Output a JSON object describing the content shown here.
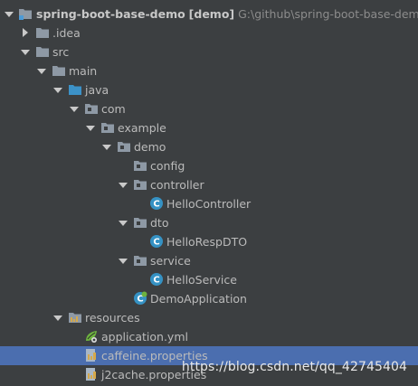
{
  "project": {
    "name": "spring-boot-base-demo",
    "module_tag": "[demo]",
    "path": "G:\\github\\spring-boot-base-demo"
  },
  "tree": {
    "idea": ".idea",
    "src": "src",
    "main": "main",
    "java": "java",
    "com": "com",
    "example": "example",
    "demo": "demo",
    "config": "config",
    "controller": "controller",
    "hello_controller": "HelloController",
    "dto": "dto",
    "hello_resp_dto": "HelloRespDTO",
    "service": "service",
    "hello_service": "HelloService",
    "demo_application": "DemoApplication",
    "resources": "resources",
    "application_yml": "application.yml",
    "caffeine_properties": "caffeine.properties",
    "j2cache_properties": "j2cache.properties"
  },
  "selected_item": "caffeine.properties",
  "watermark": "https://blog.csdn.net/qq_42745404",
  "colors": {
    "background": "#3c3f41",
    "selection": "#4b6eaf",
    "text": "#bbbbbb",
    "folder": "#8e99a5",
    "source_folder": "#3c92c8",
    "class_icon": "#3592c4"
  }
}
